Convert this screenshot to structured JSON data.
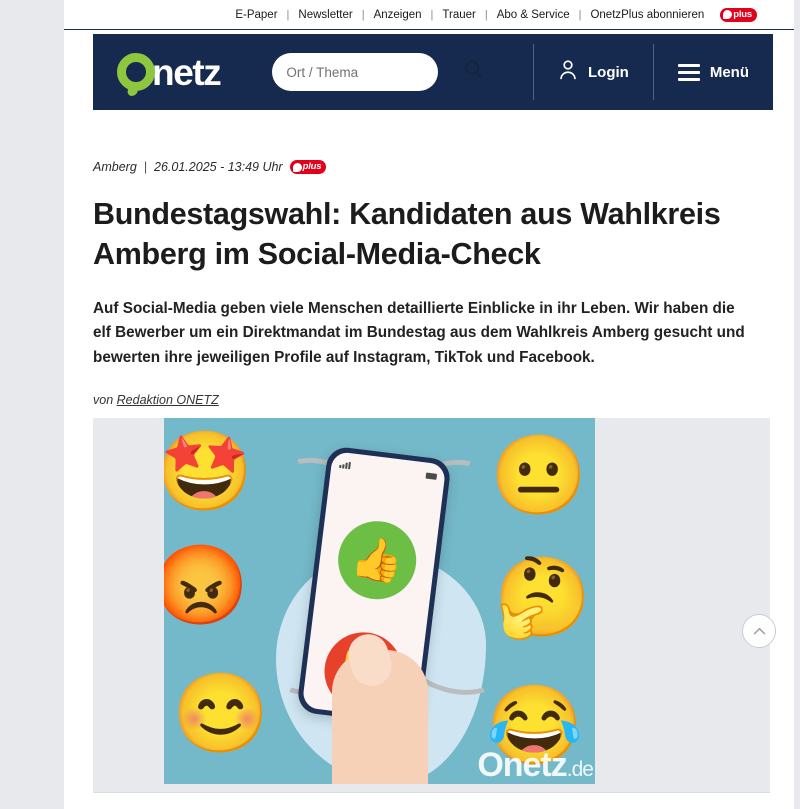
{
  "topnav": {
    "links": [
      {
        "label": "E-Paper",
        "name": "topnav-epaper"
      },
      {
        "label": "Newsletter",
        "name": "topnav-newsletter"
      },
      {
        "label": "Anzeigen",
        "name": "topnav-anzeigen"
      },
      {
        "label": "Trauer",
        "name": "topnav-trauer"
      },
      {
        "label": "Abo & Service",
        "name": "topnav-abo-service"
      },
      {
        "label": "OnetzPlus abonnieren",
        "name": "topnav-onetzplus-abonnieren"
      }
    ],
    "separator": "|",
    "plus_badge_text": "plus"
  },
  "masthead": {
    "logo_text": "netz",
    "logo_alt": "Onetz",
    "search": {
      "placeholder": "Ort / Thema",
      "value": ""
    },
    "login_label": "Login",
    "menu_label": "Menü"
  },
  "article": {
    "location": "Amberg",
    "separator": "|",
    "datetime": "26.01.2025 - 13:49 Uhr",
    "plus_badge_text": "plus",
    "headline": "Bundestagswahl: Kandidaten aus Wahlkreis Amberg im Social-Media-Check",
    "lead": "Auf Social-Media geben viele Menschen detaillierte Einblicke in ihr Leben. Wir haben die elf Bewerber um ein Direktmandat im Bundestag aus dem Wahlkreis Amberg gesucht und bewerten ihre jeweiligen Profile auf Instagram, TikTok und Facebook.",
    "byline_prefix": "von",
    "byline_author": "Redaktion ONETZ"
  },
  "hero": {
    "emojis": {
      "star_struck": "🤩",
      "neutral": "😐",
      "angry": "😡",
      "thinking": "🤔",
      "smiling": "😊",
      "joy": "😂"
    },
    "thumb_up": "👍",
    "thumb_down": "👎",
    "watermark_main": "Onetz",
    "watermark_suffix": ".de"
  },
  "colors": {
    "brand_navy": "#152a4e",
    "brand_green": "#8ec63f",
    "plus_red": "#e2001a",
    "page_gray": "#e8e9ed",
    "thumb_up_green": "#6cbe45",
    "thumb_down_red": "#e8412b",
    "photo_teal": "#74b9c9"
  }
}
